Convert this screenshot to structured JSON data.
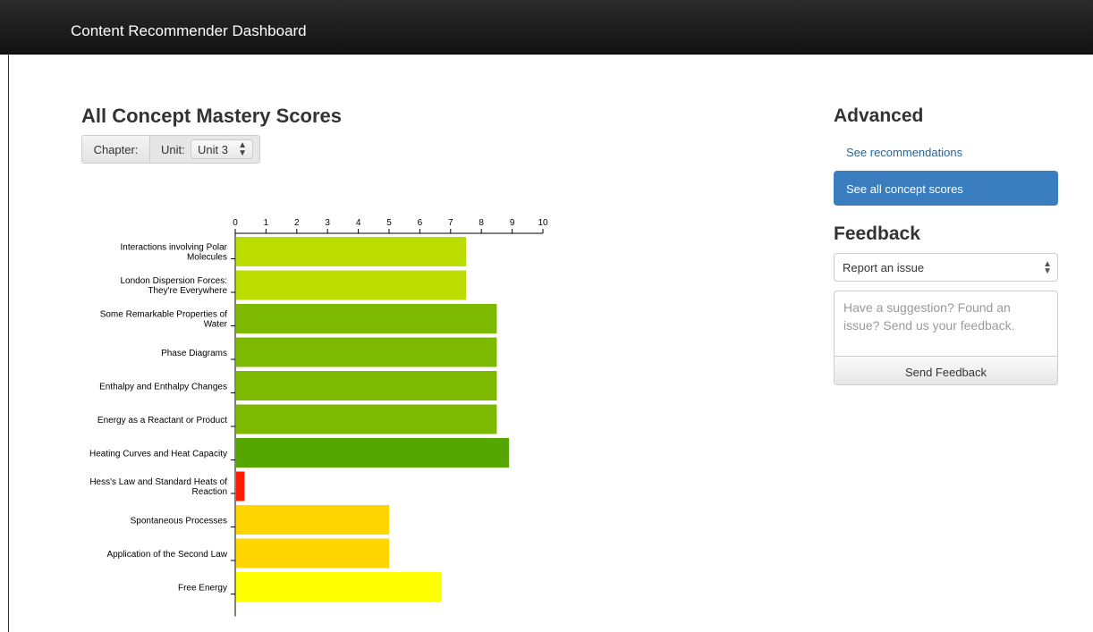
{
  "navbar": {
    "brand": "Content Recommender Dashboard"
  },
  "main": {
    "title": "All Concept Mastery Scores",
    "filters": {
      "chapter_label": "Chapter:",
      "unit_label": "Unit:",
      "unit_value": "Unit 3"
    }
  },
  "sidebar": {
    "advanced_title": "Advanced",
    "links": [
      {
        "label": "See recommendations",
        "active": false
      },
      {
        "label": "See all concept scores",
        "active": true
      }
    ],
    "feedback_title": "Feedback",
    "report_select_value": "Report an issue",
    "feedback_placeholder": "Have a suggestion? Found an issue? Send us your feedback.",
    "send_label": "Send Feedback",
    "active_color": "#3a7ebf"
  },
  "chart_data": {
    "type": "bar",
    "orientation": "horizontal",
    "xlim": [
      0,
      10
    ],
    "ticks": [
      0,
      1,
      2,
      3,
      4,
      5,
      6,
      7,
      8,
      9,
      10
    ],
    "categories": [
      "Interactions involving Polar Molecules",
      "London Dispersion Forces: They're Everywhere",
      "Some Remarkable Properties of Water",
      "Phase Diagrams",
      "Enthalpy and Enthalpy Changes",
      "Energy as a Reactant or Product",
      "Heating Curves and Heat Capacity",
      "Hess's Law and Standard Heats of Reaction",
      "Spontaneous Processes",
      "Application of the Second Law",
      "Free Energy"
    ],
    "category_lines": [
      [
        "Interactions involving Polar",
        "Molecules"
      ],
      [
        "London Dispersion Forces:",
        "They're Everywhere"
      ],
      [
        "Some Remarkable Properties of",
        "Water"
      ],
      [
        "Phase Diagrams"
      ],
      [
        "Enthalpy and Enthalpy Changes"
      ],
      [
        "Energy as a Reactant or Product"
      ],
      [
        "Heating Curves and Heat Capacity"
      ],
      [
        "Hess's Law and Standard Heats of",
        "Reaction"
      ],
      [
        "Spontaneous Processes"
      ],
      [
        "Application of the Second Law"
      ],
      [
        "Free Energy"
      ]
    ],
    "values": [
      7.5,
      7.5,
      8.5,
      8.5,
      8.5,
      8.5,
      8.9,
      0.3,
      5.0,
      5.0,
      6.7
    ],
    "colors": [
      "#bbde00",
      "#bbde00",
      "#7db900",
      "#7db900",
      "#7db900",
      "#7db900",
      "#56a600",
      "#ff1a00",
      "#ffd500",
      "#ffd500",
      "#ffff00"
    ]
  }
}
